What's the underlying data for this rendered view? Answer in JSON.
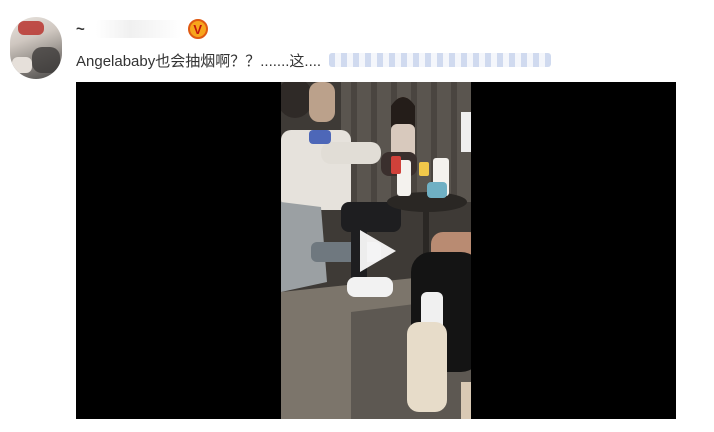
{
  "post": {
    "author": {
      "name": "~",
      "verified_badge_letter": "V",
      "verified_color": "#f7a51c"
    },
    "text": "Angelababy也会抽烟啊？？.......这...."
  },
  "video": {
    "background": "#000000",
    "play_icon": "play-icon"
  }
}
